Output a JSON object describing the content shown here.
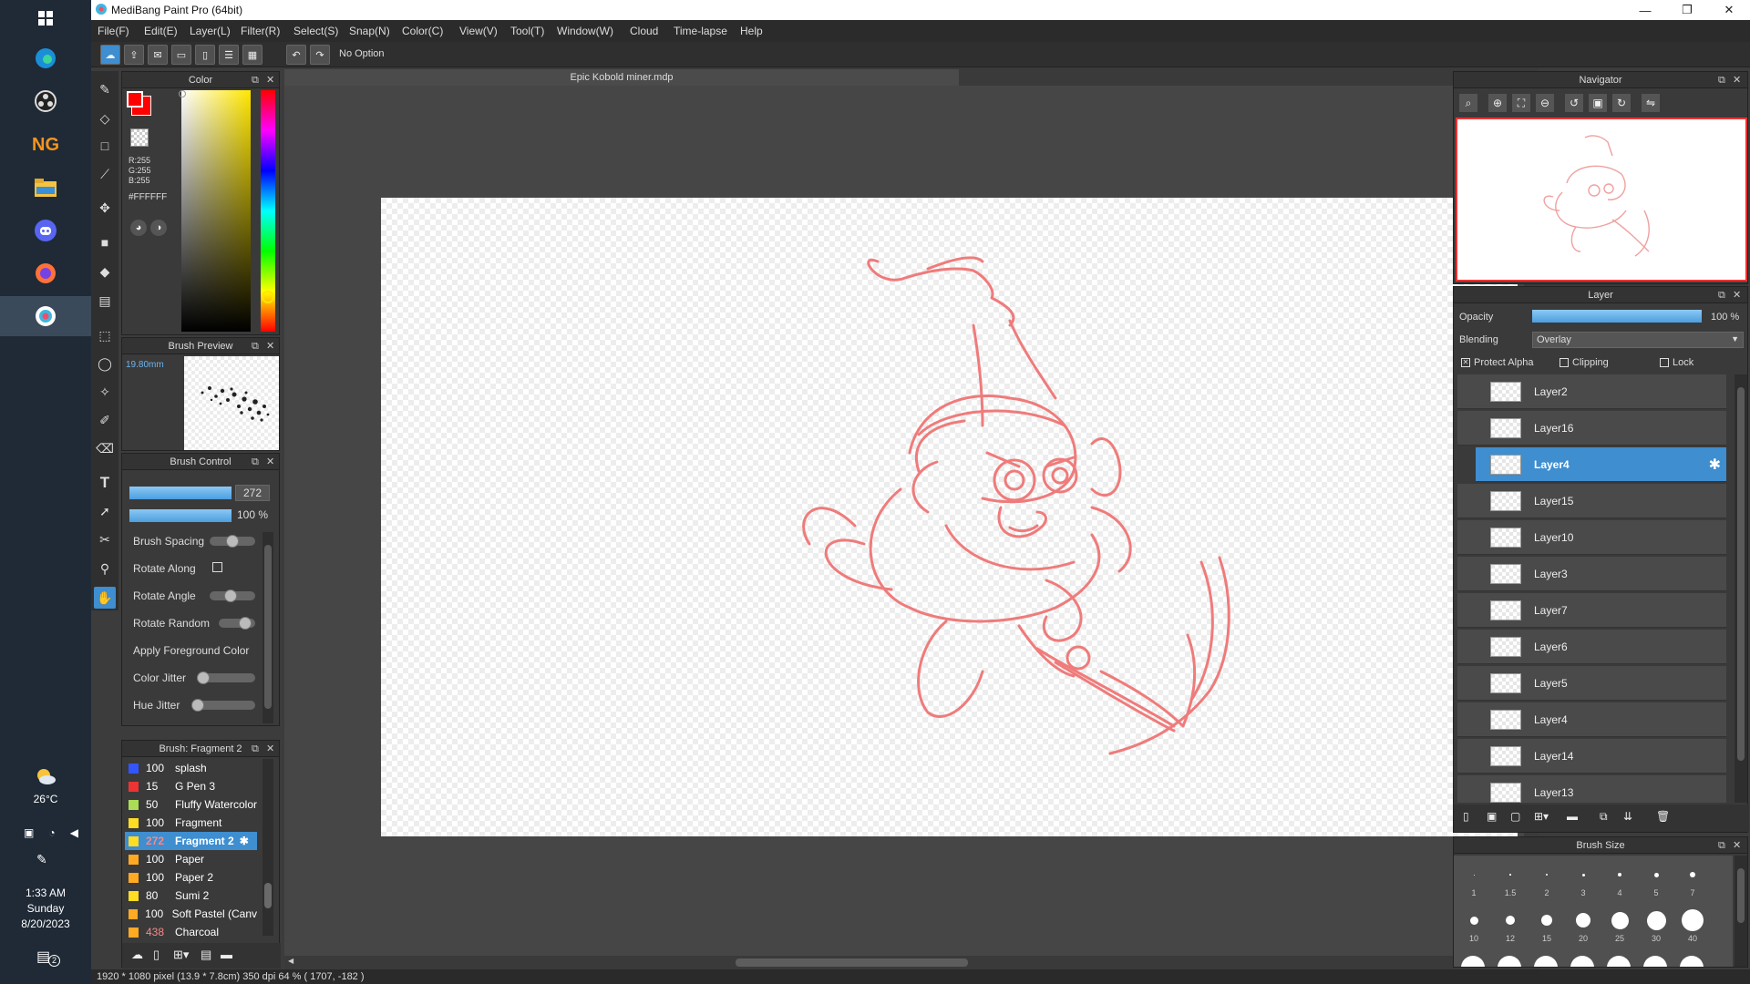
{
  "taskbar": {
    "icons": [
      "windows-icon",
      "edge-icon",
      "obs-icon",
      "newgrounds-icon",
      "file-explorer-icon",
      "discord-icon",
      "firefox-icon",
      "medibang-icon"
    ],
    "weather_temp": "26°C",
    "time": "1:33 AM",
    "day": "Sunday",
    "date": "8/20/2023",
    "notification_count": "2"
  },
  "window": {
    "title": "MediBang Paint Pro (64bit)"
  },
  "menu": [
    "File(F)",
    "Edit(E)",
    "Layer(L)",
    "Filter(R)",
    "Select(S)",
    "Snap(N)",
    "Color(C)",
    "View(V)",
    "Tool(T)",
    "Window(W)",
    "Cloud",
    "Time-lapse",
    "Help"
  ],
  "toolbar": {
    "option_text": "No Option"
  },
  "document": {
    "tab_title": "Epic Kobold miner.mdp"
  },
  "color_panel": {
    "title": "Color",
    "r": "R:255",
    "g": "G:255",
    "b": "B:255",
    "hex": "#FFFFFF",
    "foreground": "#ff0000",
    "background": "#0000ff"
  },
  "brush_preview": {
    "title": "Brush Preview",
    "size": "19.80mm"
  },
  "brush_control": {
    "title": "Brush Control",
    "size_value": "272",
    "opacity_value": "100 %",
    "options": [
      "Brush Spacing",
      "Rotate Along",
      "Rotate Angle",
      "Rotate Random",
      "Apply Foreground Color",
      "Color Jitter",
      "Hue Jitter"
    ]
  },
  "brush_list": {
    "title": "Brush: Fragment 2",
    "items": [
      {
        "size": "100",
        "name": "splash",
        "color": "#3355ff"
      },
      {
        "size": "15",
        "name": "G Pen 3",
        "color": "#ee3333"
      },
      {
        "size": "50",
        "name": "Fluffy Watercolor",
        "color": "#aadd55"
      },
      {
        "size": "100",
        "name": "Fragment",
        "color": "#ffdd22"
      },
      {
        "size": "272",
        "name": "Fragment 2",
        "color": "#ffdd22",
        "selected": true
      },
      {
        "size": "100",
        "name": "Paper",
        "color": "#ffaa22"
      },
      {
        "size": "100",
        "name": "Paper 2",
        "color": "#ffaa22"
      },
      {
        "size": "80",
        "name": "Sumi 2",
        "color": "#ffdd22"
      },
      {
        "size": "100",
        "name": "Soft Pastel (Canv",
        "color": "#ffaa22"
      },
      {
        "size": "438",
        "name": "Charcoal",
        "color": "#ffaa22"
      }
    ]
  },
  "navigator": {
    "title": "Navigator"
  },
  "layer_panel": {
    "title": "Layer",
    "opacity_label": "Opacity",
    "opacity_value": "100 %",
    "opacity": 1.0,
    "blending_label": "Blending",
    "blending_value": "Overlay",
    "protect_alpha": "Protect Alpha",
    "clipping": "Clipping",
    "lock": "Lock",
    "layers": [
      "Layer2",
      "Layer16",
      "Layer4",
      "Layer15",
      "Layer10",
      "Layer3",
      "Layer7",
      "Layer6",
      "Layer5",
      "Layer4",
      "Layer14",
      "Layer13"
    ]
  },
  "brush_size": {
    "title": "Brush Size",
    "row1": [
      "1",
      "1.5",
      "2",
      "3",
      "4",
      "5",
      "7"
    ],
    "row2": [
      "10",
      "12",
      "15",
      "20",
      "25",
      "30",
      "40"
    ]
  },
  "status": {
    "text": "1920 * 1080 pixel   (13.9 * 7.8cm)   350 dpi   64 %   ( 1707, -182 )"
  }
}
